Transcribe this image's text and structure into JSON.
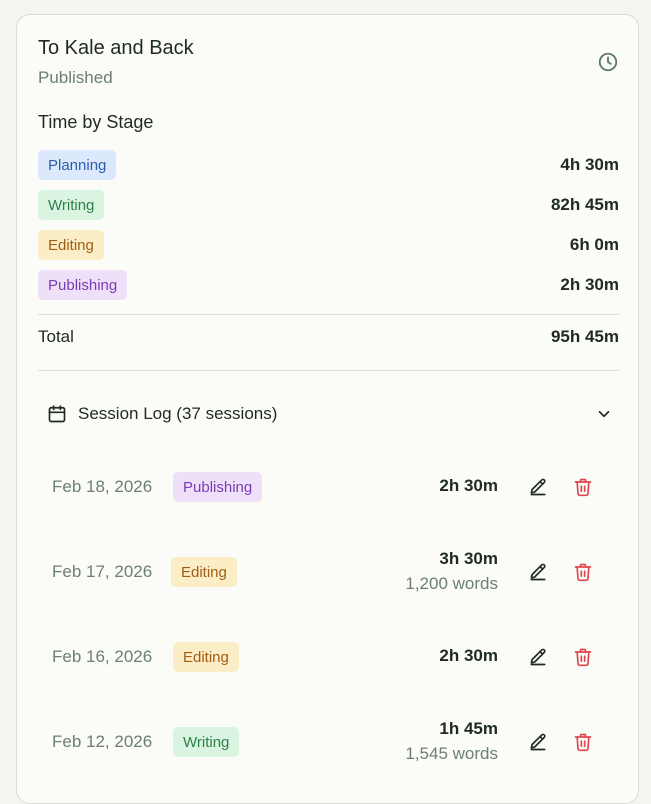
{
  "project": {
    "title": "To Kale and Back",
    "status": "Published"
  },
  "time_by_stage": {
    "heading": "Time by Stage",
    "stages": [
      {
        "label": "Planning",
        "time": "4h 30m"
      },
      {
        "label": "Writing",
        "time": "82h 45m"
      },
      {
        "label": "Editing",
        "time": "6h 0m"
      },
      {
        "label": "Publishing",
        "time": "2h 30m"
      }
    ],
    "total_label": "Total",
    "total_value": "95h 45m"
  },
  "session_log": {
    "title": "Session Log (37 sessions)",
    "sessions": [
      {
        "date": "Feb 18, 2026",
        "stage": "Publishing",
        "duration": "2h 30m",
        "words": ""
      },
      {
        "date": "Feb 17, 2026",
        "stage": "Editing",
        "duration": "3h 30m",
        "words": "1,200 words"
      },
      {
        "date": "Feb 16, 2026",
        "stage": "Editing",
        "duration": "2h 30m",
        "words": ""
      },
      {
        "date": "Feb 12, 2026",
        "stage": "Writing",
        "duration": "1h 45m",
        "words": "1,545 words"
      }
    ]
  },
  "icons": {
    "clock": "clock-icon",
    "calendar": "calendar-icon",
    "chevron": "chevron-down-icon",
    "edit": "pencil-icon",
    "delete": "trash-icon"
  },
  "colors": {
    "planning": "#2c5fb0",
    "writing": "#2e8049",
    "editing": "#a25d15",
    "publishing": "#7a3cb4",
    "delete": "#e0474c",
    "muted": "#6c7f72"
  }
}
